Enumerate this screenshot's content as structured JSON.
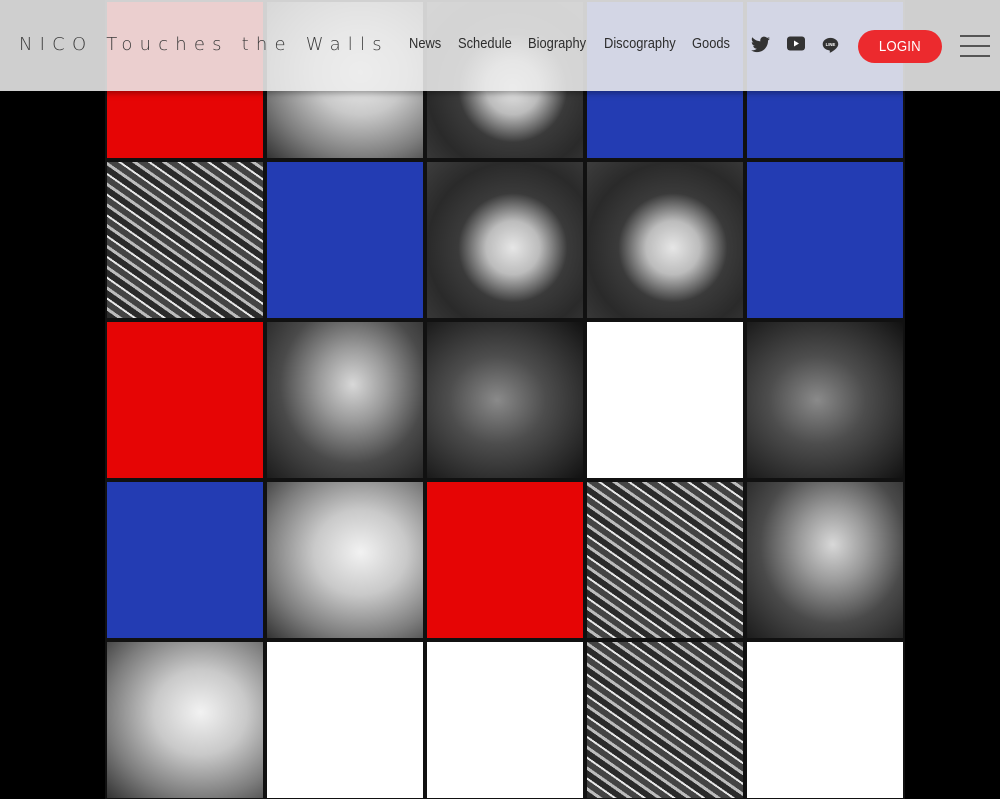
{
  "site": {
    "logo_text": "NICO Touches the Walls"
  },
  "nav": {
    "items": [
      {
        "label": "News"
      },
      {
        "label": "Schedule"
      },
      {
        "label": "Biography"
      },
      {
        "label": "Discography"
      },
      {
        "label": "Goods"
      }
    ]
  },
  "social": {
    "icons": [
      "twitter-icon",
      "youtube-icon",
      "line-icon"
    ]
  },
  "header_actions": {
    "login_label": "LOGIN",
    "menu_icon": "hamburger-menu-icon"
  },
  "colors": {
    "accent_red": "#e60505",
    "accent_blue": "#233cb3",
    "login_red": "#ec2a2e",
    "header_bg": "#ececec",
    "grid_line": "#111111"
  },
  "hero": {
    "description": "Mondrian-style 5x5 grid of band member photo tiles and solid red/blue/white blocks",
    "grid": [
      [
        "red",
        "photo",
        "photo",
        "blue",
        "blue"
      ],
      [
        "photo",
        "blue",
        "photo",
        "photo",
        "blue"
      ],
      [
        "red",
        "photo",
        "photo",
        "white",
        "photo"
      ],
      [
        "blue",
        "photo",
        "red",
        "photo",
        "photo"
      ],
      [
        "photo",
        "white",
        "white",
        "photo",
        "white"
      ]
    ]
  }
}
